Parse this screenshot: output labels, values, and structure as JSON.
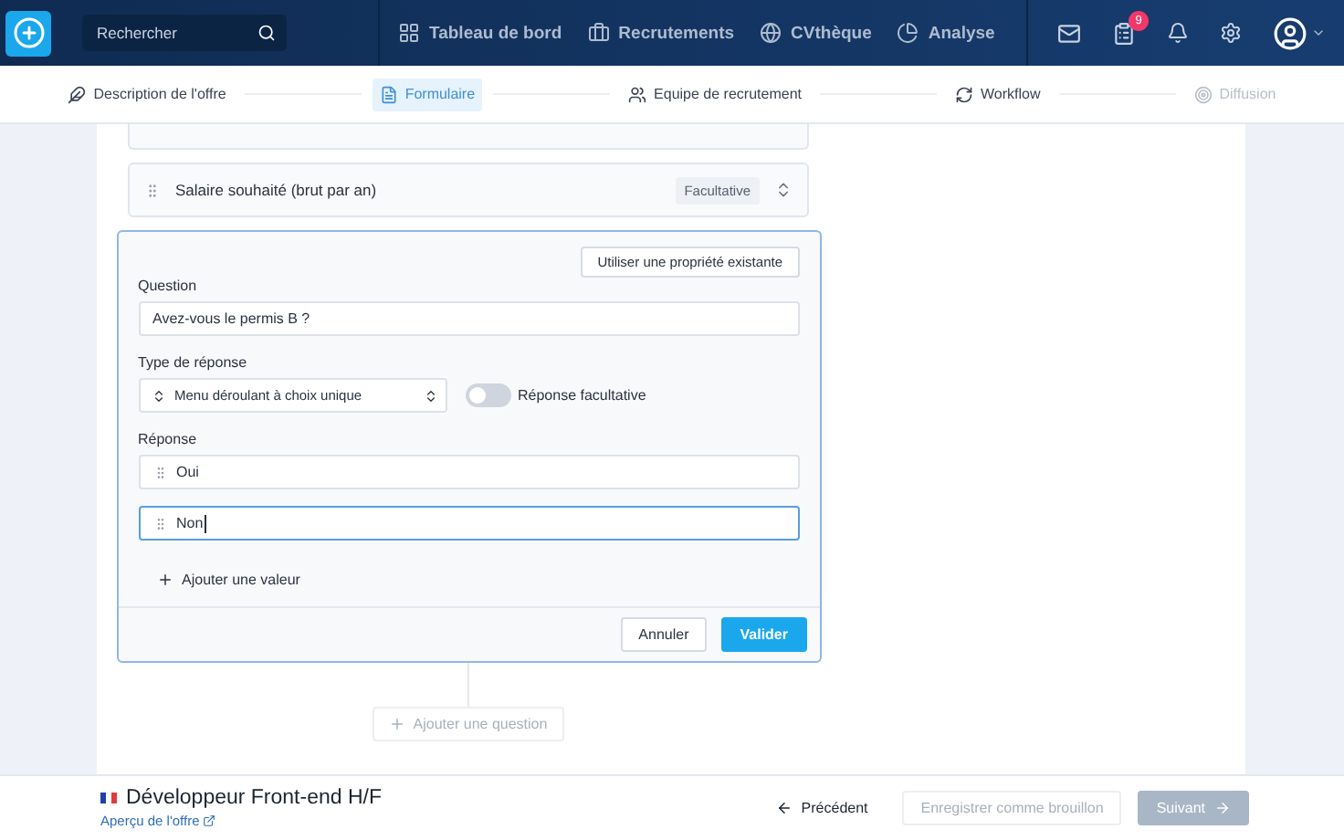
{
  "header": {
    "search": {
      "placeholder": "Rechercher"
    },
    "nav": [
      {
        "label": "Tableau de bord",
        "kind": "dashboard"
      },
      {
        "label": "Recrutements",
        "kind": "briefcase"
      },
      {
        "label": "CVthèque",
        "kind": "globe"
      },
      {
        "label": "Analyse",
        "kind": "chart"
      }
    ],
    "tasks_badge": "9"
  },
  "steps": [
    {
      "label": "Description de l'offre",
      "kind": "pen",
      "selected": false,
      "disabled": false
    },
    {
      "label": "Formulaire",
      "kind": "form",
      "selected": true,
      "disabled": false
    },
    {
      "label": "Equipe de recrutement",
      "kind": "team",
      "selected": false,
      "disabled": false
    },
    {
      "label": "Workflow",
      "kind": "workflow",
      "selected": false,
      "disabled": false
    },
    {
      "label": "Diffusion",
      "kind": "broadcast",
      "selected": false,
      "disabled": true
    }
  ],
  "questions": [
    {
      "label": "Salaire souhaité (brut par an)",
      "badge": "Facultative"
    }
  ],
  "editor": {
    "use_property_button": "Utiliser une propriété existante",
    "question_label": "Question",
    "question_value": "Avez-vous le permis B ?",
    "type_label": "Type de réponse",
    "type_value": "Menu déroulant à choix unique",
    "optional_toggle": {
      "label": "Réponse facultative",
      "on": false
    },
    "answers_label": "Réponse",
    "answers": [
      {
        "value": "Oui",
        "focused": false
      },
      {
        "value": "Non",
        "focused": true
      }
    ],
    "add_value": "Ajouter une valeur",
    "cancel": "Annuler",
    "validate": "Valider"
  },
  "add_question": "Ajouter une question",
  "footer": {
    "title": "Développeur Front-end H/F",
    "preview_link": "Aperçu de l'offre",
    "previous": "Précédent",
    "save_draft": "Enregistrer comme brouillon",
    "next": "Suivant"
  }
}
